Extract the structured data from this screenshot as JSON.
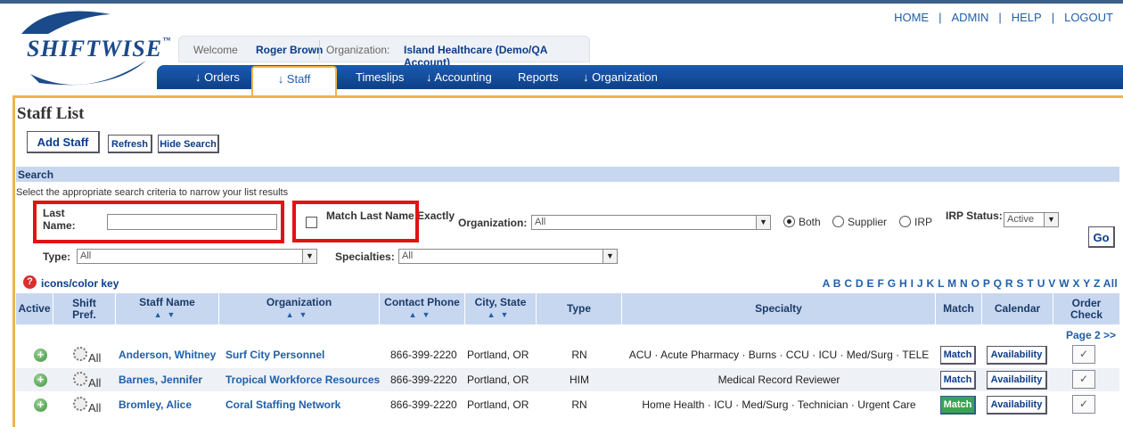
{
  "header": {
    "logo_text": "SHIFTWISE",
    "logo_tm": "™",
    "welcome_label": "Welcome",
    "user_name": "Roger Brown",
    "org_label": "Organization:",
    "org_name": "Island Healthcare (Demo/QA Account)"
  },
  "topnav": {
    "home": "HOME",
    "admin": "ADMIN",
    "help": "HELP",
    "logout": "LOGOUT",
    "sep": "|"
  },
  "navbar": {
    "orders": "↓ Orders",
    "staff": "↓ Staff",
    "timeslips": "Timeslips",
    "accounting": "↓ Accounting",
    "reports": "Reports",
    "organization": "↓ Organization"
  },
  "page": {
    "title": "Staff List",
    "add_staff": "Add Staff",
    "refresh": "Refresh",
    "hide_search": "Hide Search"
  },
  "search": {
    "header": "Search",
    "help": "Select the appropriate search criteria to narrow your list results",
    "last_name_label": "Last Name:",
    "last_name_value": "",
    "match_label": "Match Last Name Exactly",
    "org_label": "Organization:",
    "org_value": "All",
    "radio_both": "Both",
    "radio_supplier": "Supplier",
    "radio_irp": "IRP",
    "irp_status_label": "IRP Status:",
    "irp_status_value": "Active",
    "go": "Go",
    "type_label": "Type:",
    "type_value": "All",
    "specialties_label": "Specialties:",
    "specialties_value": "All"
  },
  "key": {
    "help_glyph": "?",
    "link": "icons/color key"
  },
  "alphabet": "A B C D E F G H I J K L M N O P Q R S T U V W X Y Z All",
  "table": {
    "headers": {
      "active": "Active",
      "shift_pref": "Shift Pref.",
      "staff_name": "Staff Name",
      "organization": "Organization",
      "contact_phone": "Contact Phone",
      "city_state": "City, State",
      "type": "Type",
      "specialty": "Specialty",
      "match": "Match",
      "calendar": "Calendar",
      "order_check": "Order Check"
    },
    "sort_glyph": "▲▼",
    "page_link": "Page 2 >>",
    "rows": [
      {
        "shift": "All",
        "name": "Anderson, Whitney",
        "org": "Surf City Personnel",
        "phone": "866-399-2220",
        "city": "Portland, OR",
        "type": "RN",
        "specialty": "ACU · Acute Pharmacy · Burns · CCU · ICU · Med/Surg · TELE",
        "match": "Match",
        "calendar": "Availability",
        "check": "✓"
      },
      {
        "shift": "All",
        "name": "Barnes, Jennifer",
        "org": "Tropical Workforce Resources",
        "phone": "866-399-2220",
        "city": "Portland, OR",
        "type": "HIM",
        "specialty": "Medical Record Reviewer",
        "match": "Match",
        "calendar": "Availability",
        "check": "✓"
      },
      {
        "shift": "All",
        "name": "Bromley, Alice",
        "org": "Coral Staffing Network",
        "phone": "866-399-2220",
        "city": "Portland, OR",
        "type": "RN",
        "specialty": "Home Health · ICU · Med/Surg · Technician · Urgent Care",
        "match": "Match",
        "calendar": "Availability",
        "check": "✓"
      }
    ]
  }
}
